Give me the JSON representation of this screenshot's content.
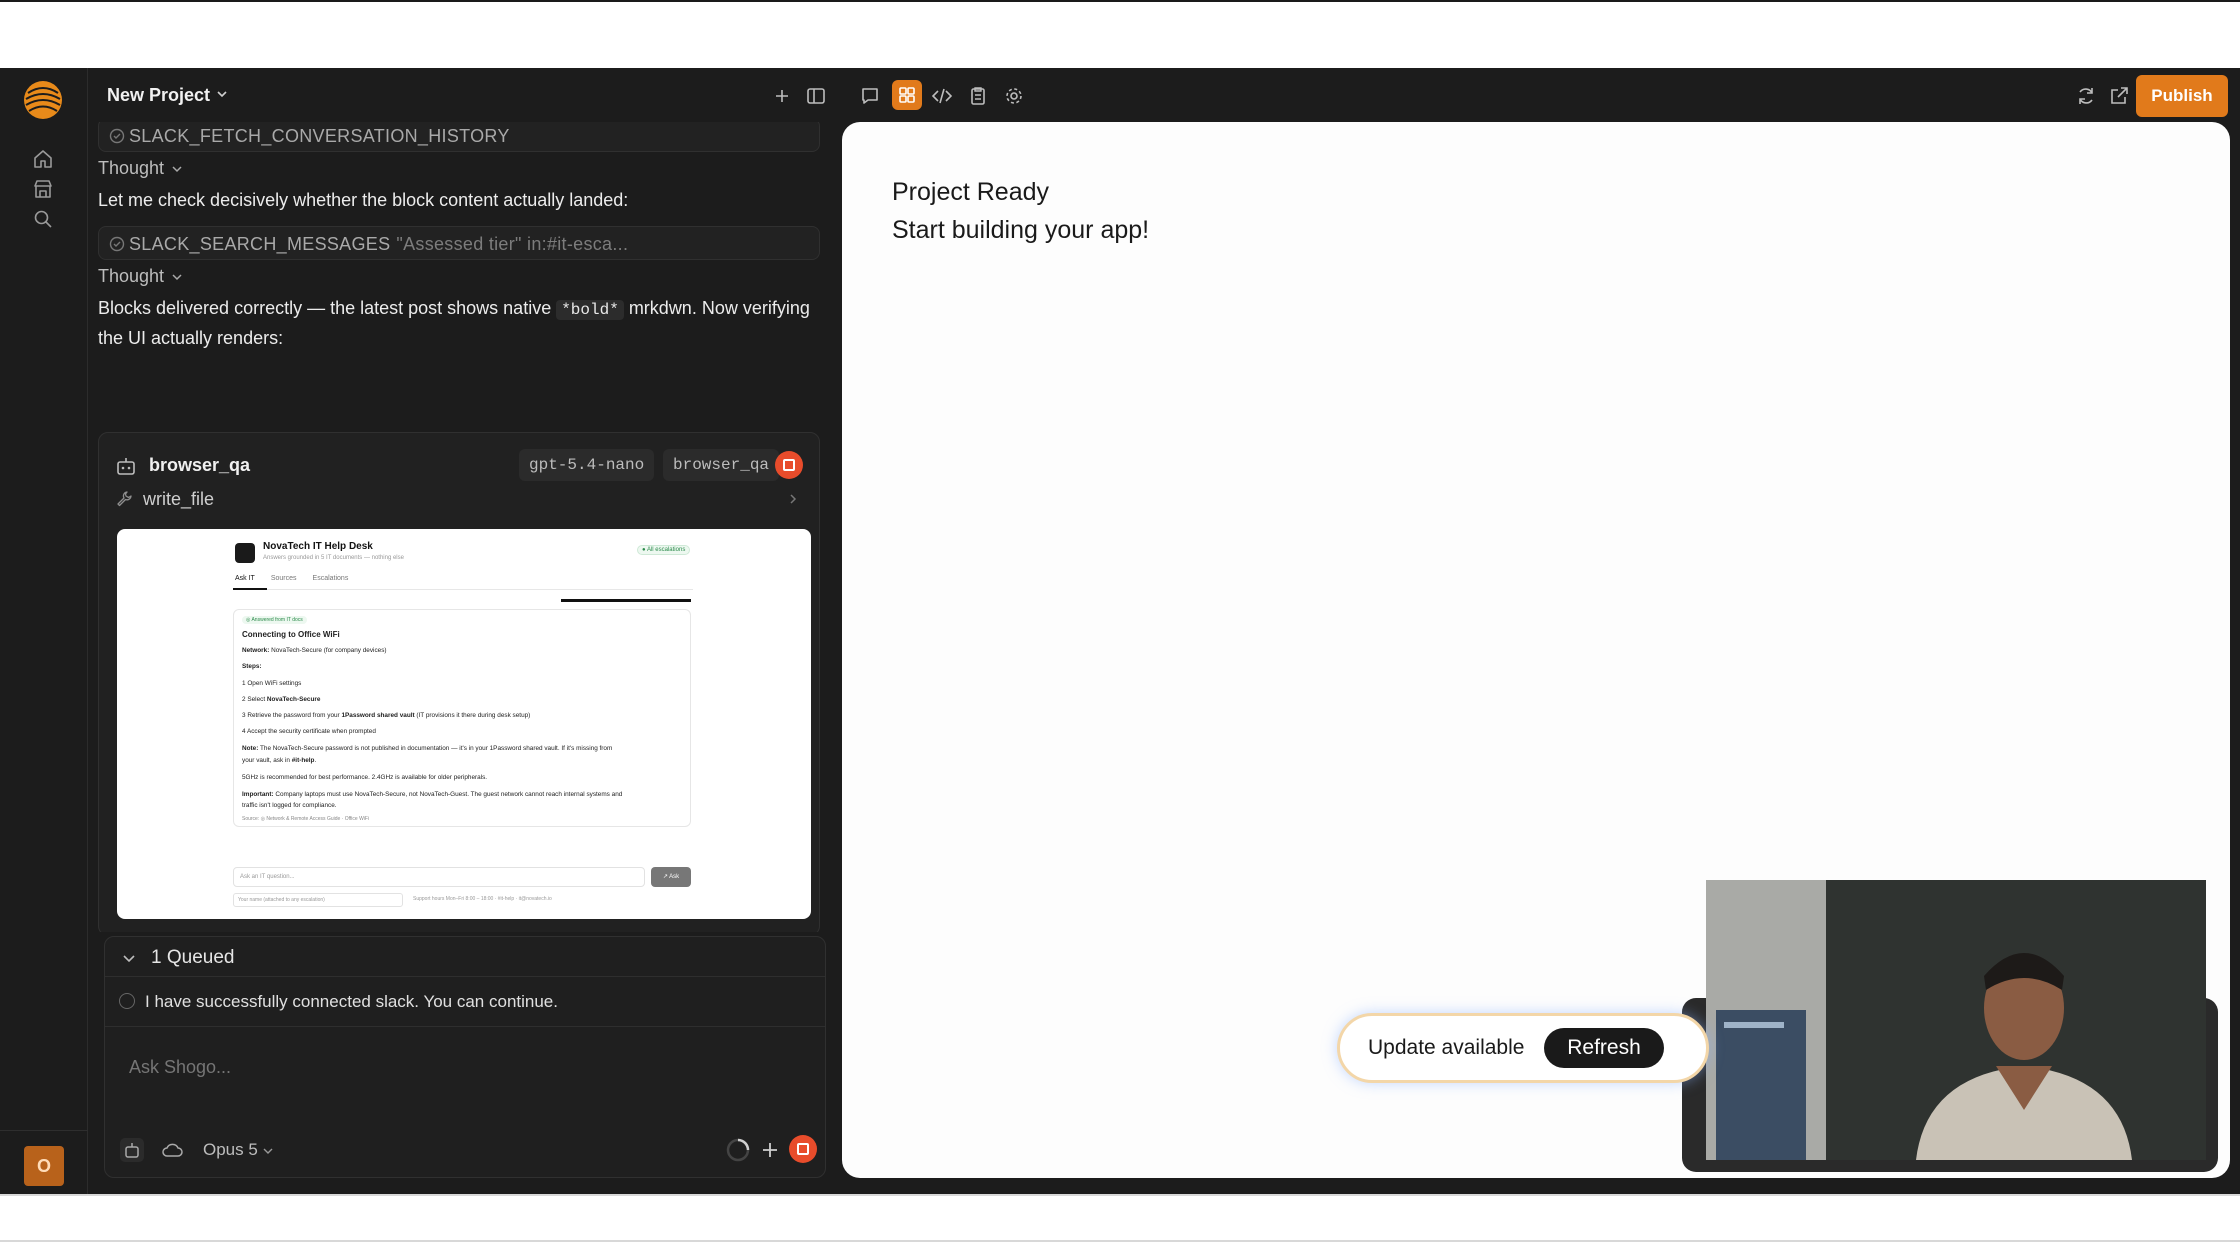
{
  "header": {
    "project_title": "New Project",
    "publish_label": "Publish"
  },
  "rail": {
    "avatar_initial": "O"
  },
  "messages": {
    "tool1": {
      "name": "SLACK_FETCH_CONVERSATION_HISTORY"
    },
    "thought1": "Thought",
    "text1": "Let me check decisively whether the block content actually landed:",
    "tool2": {
      "name": "SLACK_SEARCH_MESSAGES",
      "arg": "\"Assessed tier\" in:#it-esca..."
    },
    "thought2": "Thought",
    "text2_a": "Blocks delivered correctly — the latest post shows native ",
    "text2_code": "*bold*",
    "text2_b": " mrkdwn. Now verifying the UI actually renders:"
  },
  "agent_card": {
    "name": "browser_qa",
    "tag_model": "gpt-5.4-nano",
    "tag_agent": "browser_qa",
    "step": "write_file"
  },
  "screenshot": {
    "title": "NovaTech IT Help Desk",
    "subtitle": "Answers grounded in 5 IT documents — nothing else",
    "badge": "● All escalations",
    "tabs": [
      "Ask IT",
      "Sources",
      "Escalations"
    ],
    "answer_badge": "◎ Answered from IT docs",
    "heading": "Connecting to Office WiFi",
    "network_label": "Network:",
    "network_value": " NovaTech-Secure (for company devices)",
    "steps_label": "Steps:",
    "step1": "1   Open WiFi settings",
    "step2_a": "2   Select ",
    "step2_b": "NovaTech-Secure",
    "step3_a": "3   Retrieve the password from your ",
    "step3_b": "1Password shared vault",
    "step3_c": " (IT provisions it there during desk setup)",
    "step4": "4   Accept the security certificate when prompted",
    "note_label": "Note:",
    "note_text": " The NovaTech-Secure password is not published in documentation — it's in your 1Password shared vault. If it's missing from",
    "note_text2_a": "your vault, ask in ",
    "note_text2_b": "#it-help",
    "note_text2_c": ".",
    "band_text": "5GHz is recommended for best performance. 2.4GHz is available for older peripherals.",
    "important_label": "Important:",
    "important_text": " Company laptops must use NovaTech-Secure, not NovaTech-Guest. The guest network cannot reach internal systems and",
    "important_text2": "traffic isn't logged for compliance.",
    "source": "Source:  ◎ Network & Remote Access Guide · Office WiFi",
    "input_placeholder": "Ask an IT question...",
    "ask_label": "↗ Ask",
    "name_placeholder": "Your name (attached to any escalation)",
    "hours": "Support hours Mon–Fri 8:00 – 18:00 · #it-help · it@novatech.io"
  },
  "queue": {
    "title": "1 Queued",
    "item": "I have successfully connected slack. You can continue."
  },
  "composer": {
    "placeholder": "Ask Shogo...",
    "model": "Opus 5"
  },
  "preview": {
    "line1": "Project Ready",
    "line2": "Start building your app!"
  },
  "update": {
    "text": "Update available",
    "button": "Refresh"
  },
  "colors": {
    "accent": "#e17a1b",
    "stop": "#e84c2b",
    "panel_bg": "#1c1c1c",
    "preview_bg": "#fdfdfd"
  }
}
